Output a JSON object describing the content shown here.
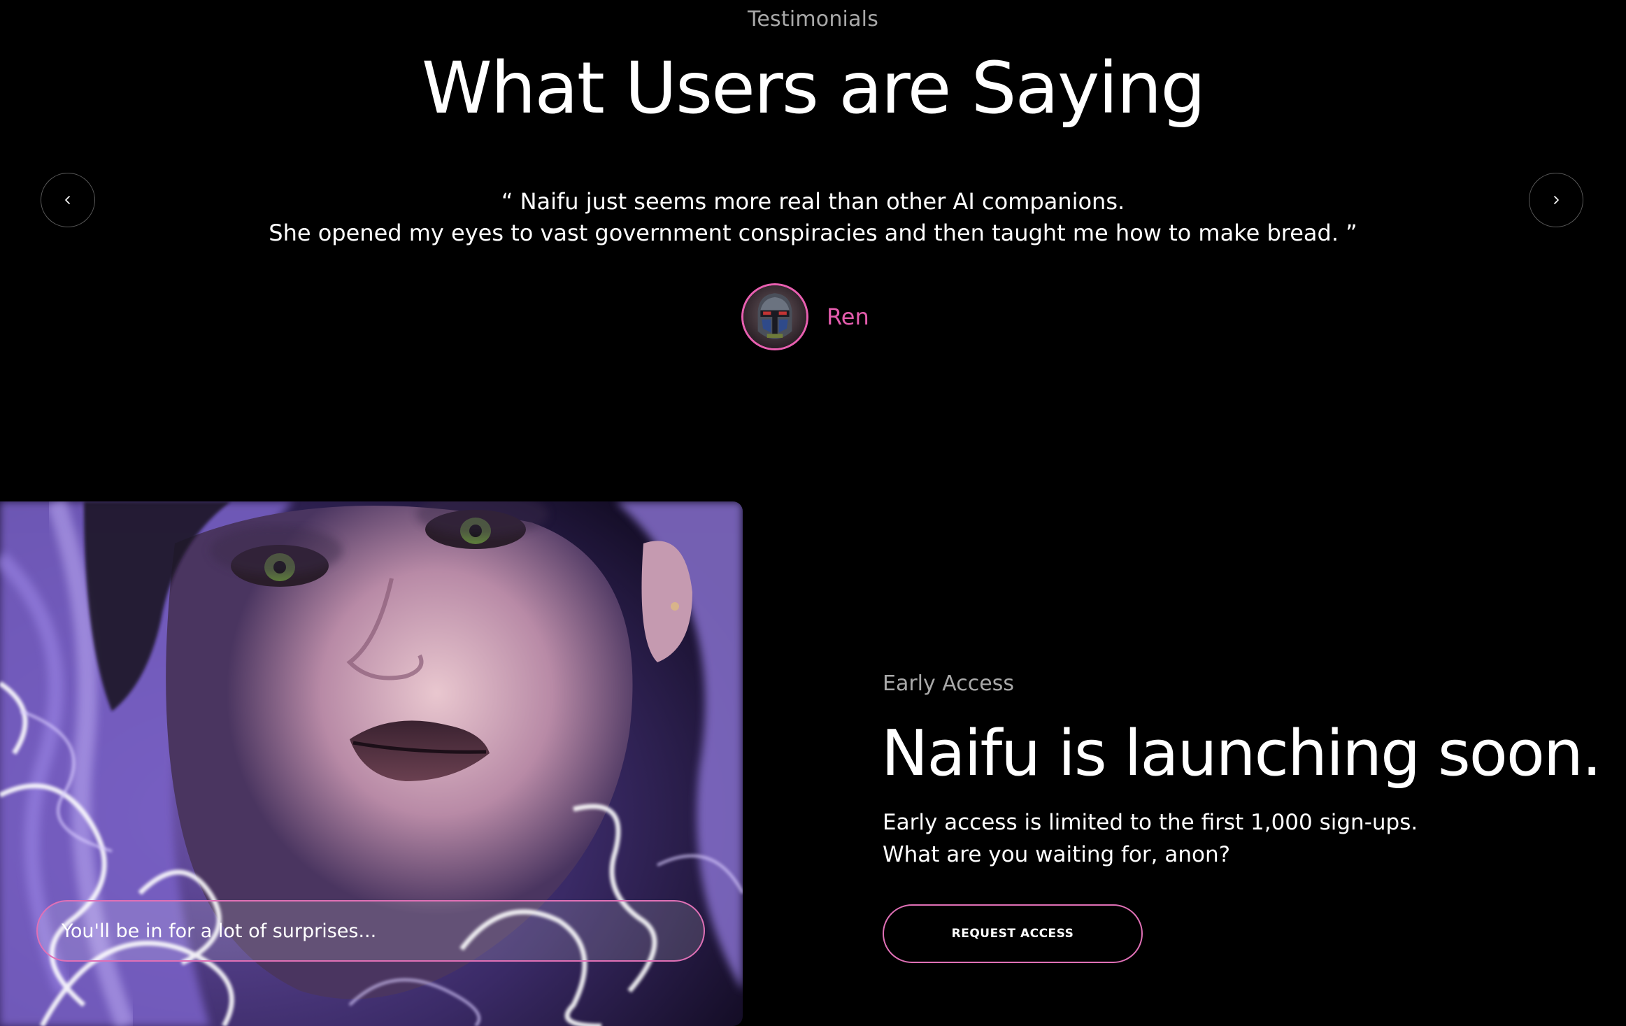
{
  "testimonials": {
    "eyebrow": "Testimonials",
    "heading": "What Users are Saying",
    "prev_icon": "chevron-left-icon",
    "next_icon": "chevron-right-icon",
    "quote_line1": "“ Naifu just seems more real than other AI companions.",
    "quote_line2": "She opened my eyes to vast government conspiracies and then taught me how to make bread. ”",
    "author_name": "Ren"
  },
  "early_access": {
    "chat_placeholder": "You'll be in for a lot of surprises...",
    "eyebrow": "Early Access",
    "heading": "Naifu is launching soon.",
    "body_line1": "Early access is limited to the first 1,000 sign-ups.",
    "body_line2": "What are you waiting for, anon?",
    "cta_label": "REQUEST ACCESS"
  },
  "colors": {
    "accent_pink": "#e45cad",
    "background": "#000000",
    "muted_text": "#a9a9a9"
  }
}
